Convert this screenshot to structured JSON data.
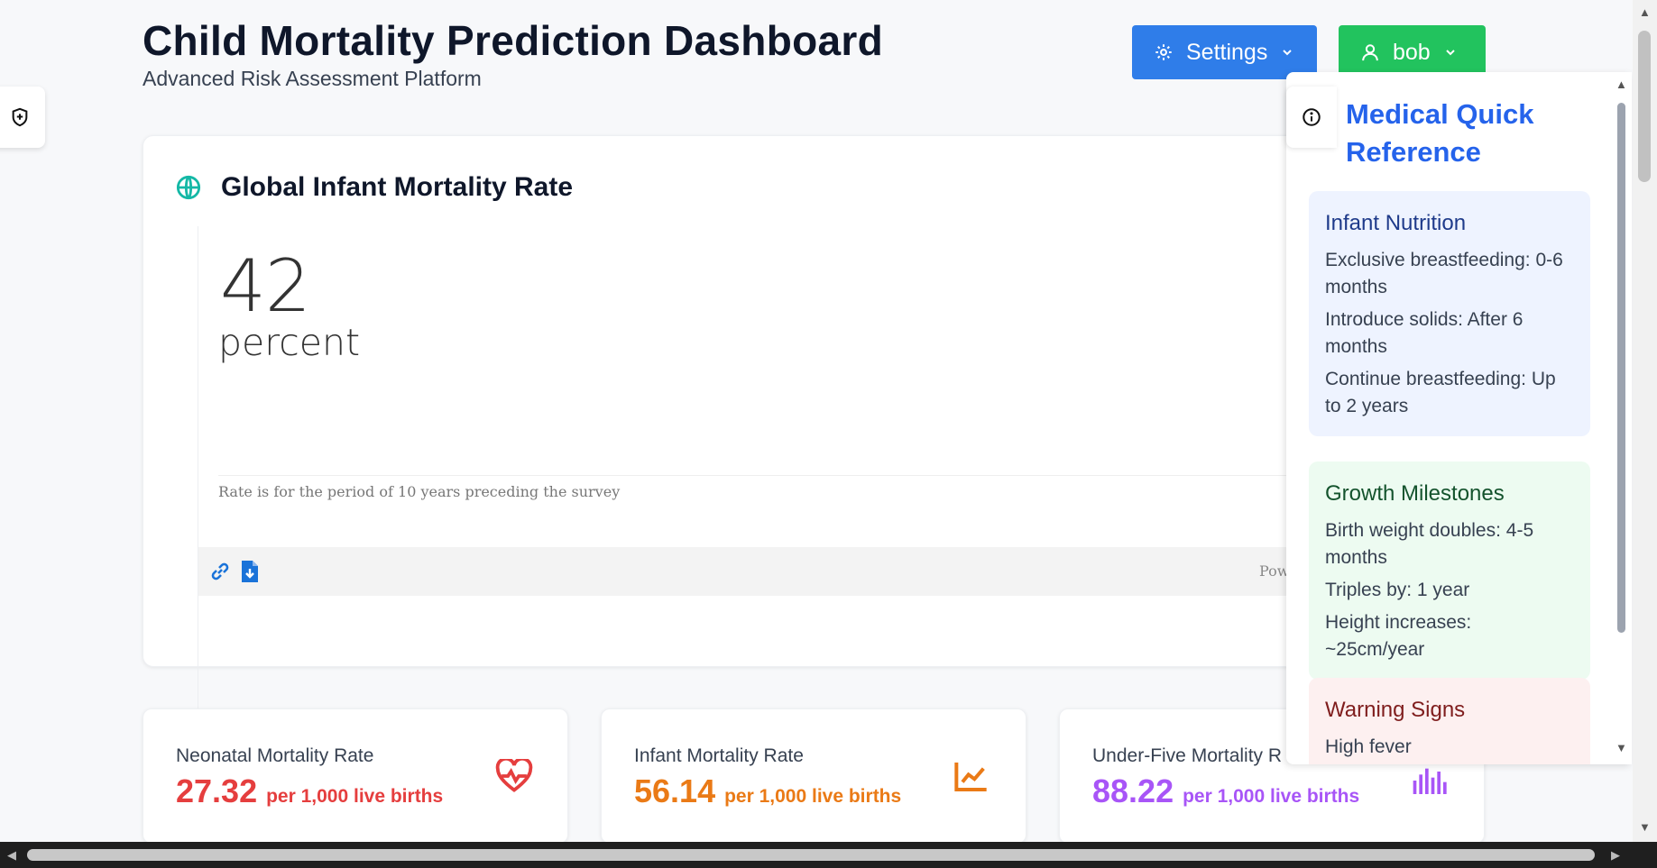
{
  "header": {
    "title": "Child Mortality Prediction Dashboard",
    "subtitle": "Advanced Risk Assessment Platform",
    "settings_label": "Settings",
    "user_label": "bob"
  },
  "main_card": {
    "title": "Global Infant Mortality Rate",
    "value": "42",
    "unit": "percent",
    "footnote": "Rate is for the period of 10 years preceding the survey",
    "powered_by": "Powered by"
  },
  "stats": [
    {
      "label": "Neonatal Mortality Rate",
      "value": "27.32",
      "unit": "per 1,000 live births",
      "color": "#e53e3e",
      "icon": "heart-pulse-icon"
    },
    {
      "label": "Infant Mortality Rate",
      "value": "56.14",
      "unit": "per 1,000 live births",
      "color": "#ea7a16",
      "icon": "trend-chart-icon"
    },
    {
      "label": "Under-Five Mortality R",
      "value": "88.22",
      "unit": "per 1,000 live births",
      "color": "#a855f7",
      "icon": "bar-chart-icon"
    }
  ],
  "panel": {
    "title": "Medical Quick Reference",
    "sections": [
      {
        "title": "Infant Nutrition",
        "items": [
          "Exclusive breastfeeding: 0-6 months",
          "Introduce solids: After 6 months",
          "Continue breastfeeding: Up to 2 years"
        ]
      },
      {
        "title": "Growth Milestones",
        "items": [
          "Birth weight doubles: 4-5 months",
          "Triples by: 1 year",
          "Height increases: ~25cm/year"
        ]
      },
      {
        "title": "Warning Signs",
        "items": [
          "High fever"
        ]
      }
    ]
  },
  "colors": {
    "settings_button": "#2f7de9",
    "user_button": "#22c35e",
    "panel_title": "#2563eb"
  }
}
